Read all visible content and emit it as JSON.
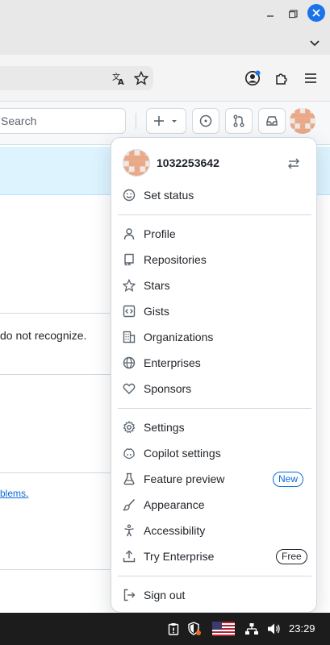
{
  "header": {
    "search_placeholder": "Search"
  },
  "page": {
    "text_fragment": "do not recognize.",
    "link_fragment": "blems"
  },
  "menu": {
    "username": "1032253642",
    "set_status": "Set status",
    "group1": [
      {
        "label": "Profile",
        "icon": "person-icon"
      },
      {
        "label": "Repositories",
        "icon": "repo-icon"
      },
      {
        "label": "Stars",
        "icon": "star-icon"
      },
      {
        "label": "Gists",
        "icon": "code-square-icon"
      },
      {
        "label": "Organizations",
        "icon": "organization-icon"
      },
      {
        "label": "Enterprises",
        "icon": "globe-icon"
      },
      {
        "label": "Sponsors",
        "icon": "heart-icon"
      }
    ],
    "group2": [
      {
        "label": "Settings",
        "icon": "gear-icon"
      },
      {
        "label": "Copilot settings",
        "icon": "copilot-icon"
      },
      {
        "label": "Feature preview",
        "icon": "beaker-icon",
        "badge": "New"
      },
      {
        "label": "Appearance",
        "icon": "paintbrush-icon"
      },
      {
        "label": "Accessibility",
        "icon": "accessibility-icon"
      },
      {
        "label": "Try Enterprise",
        "icon": "upload-icon",
        "badge": "Free"
      }
    ],
    "sign_out": "Sign out"
  },
  "taskbar": {
    "clock": "23:29"
  },
  "colors": {
    "accent": "#0969da",
    "banner": "#ddf4ff",
    "avatar": "#e8a989"
  }
}
